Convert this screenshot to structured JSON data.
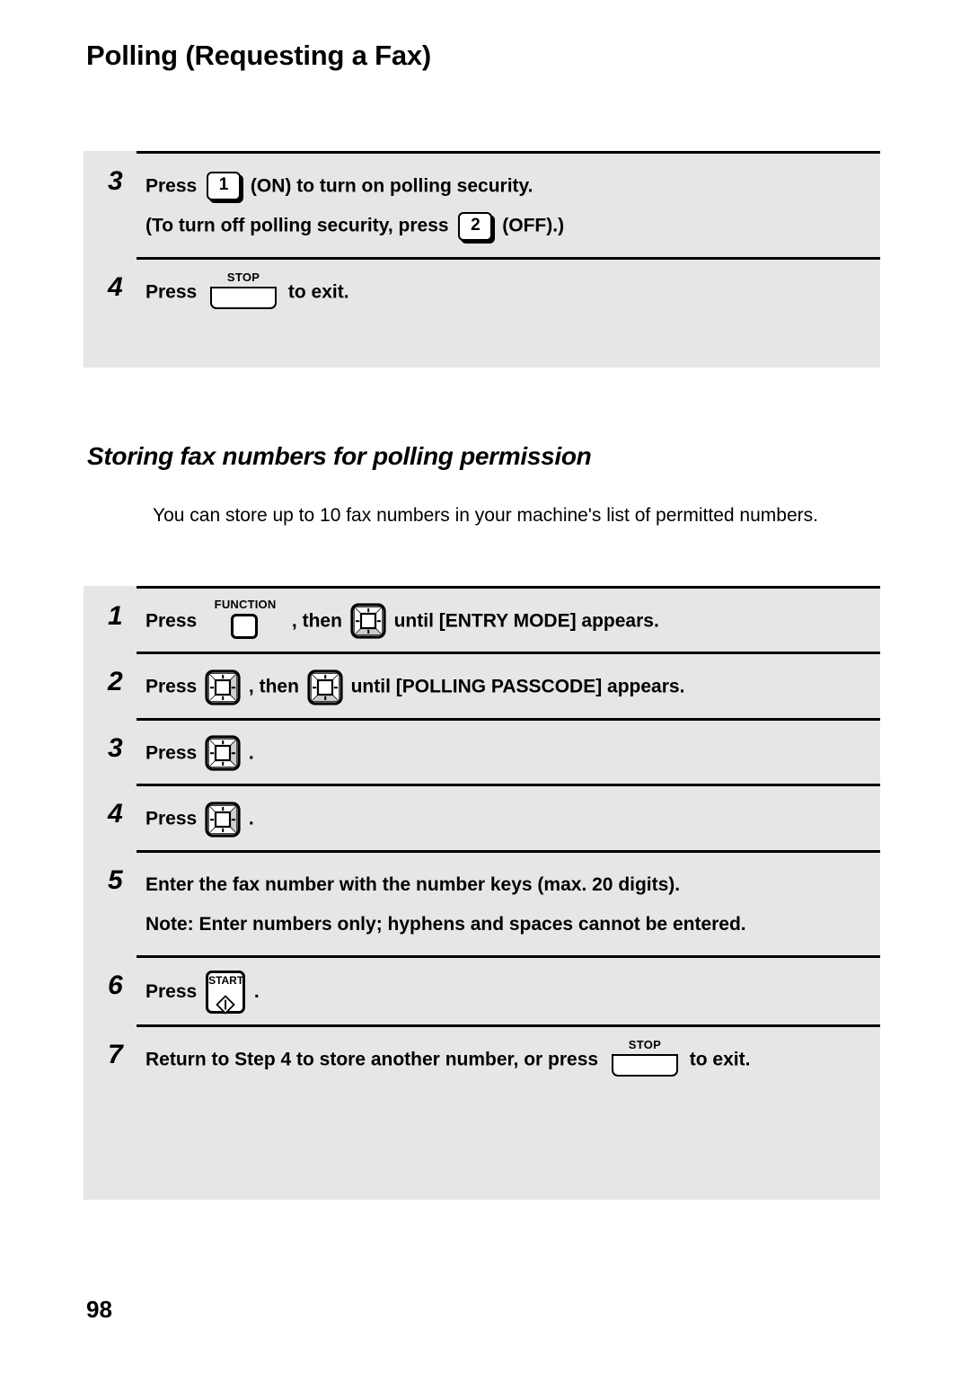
{
  "document": {
    "page_title": "Polling (Requesting a Fax)",
    "page_number": "98",
    "section_heading": "Storing fax numbers for polling permission",
    "intro_paragraph": "You can store up to 10 fax numbers in your machine's list of permitted numbers."
  },
  "keys": {
    "one_label": "1",
    "two_label": "2",
    "stop_label": "STOP",
    "function_label": "FUNCTION",
    "start_label": "START"
  },
  "panel_one": {
    "steps": [
      {
        "number": "3",
        "line1_before": "Press",
        "line1_key": "1",
        "line1_after": "(ON) to turn on polling security.",
        "line2_before": "(To turn off polling security, press",
        "line2_key": "2",
        "line2_after": "(OFF).)"
      },
      {
        "number": "4",
        "line1_before": "Press",
        "line1_after": "to exit."
      }
    ]
  },
  "panel_two": {
    "steps": [
      {
        "number": "1",
        "text_before": "Press",
        "text_middle": ", then",
        "text_after": "until [ENTRY MODE] appears."
      },
      {
        "number": "2",
        "text_before": "Press",
        "text_middle": ", then",
        "text_after": "until [POLLING PASSCODE] appears."
      },
      {
        "number": "3",
        "text_before": "Press",
        "text_after": "."
      },
      {
        "number": "4",
        "text_before": "Press",
        "text_after": "."
      },
      {
        "number": "5",
        "line1": "Enter the fax number with the number keys (max. 20 digits).",
        "line2": "Note: Enter numbers only; hyphens and spaces cannot be entered."
      },
      {
        "number": "6",
        "text_before": "Press",
        "text_after": "."
      },
      {
        "number": "7",
        "text_before": "Return to Step 4 to store another number, or press",
        "text_after": "to exit."
      }
    ]
  },
  "colors": {
    "panel_background": "#e6e6e6",
    "rule": "#000000",
    "page_background": "#ffffff",
    "key_shade": "#cccccc"
  }
}
